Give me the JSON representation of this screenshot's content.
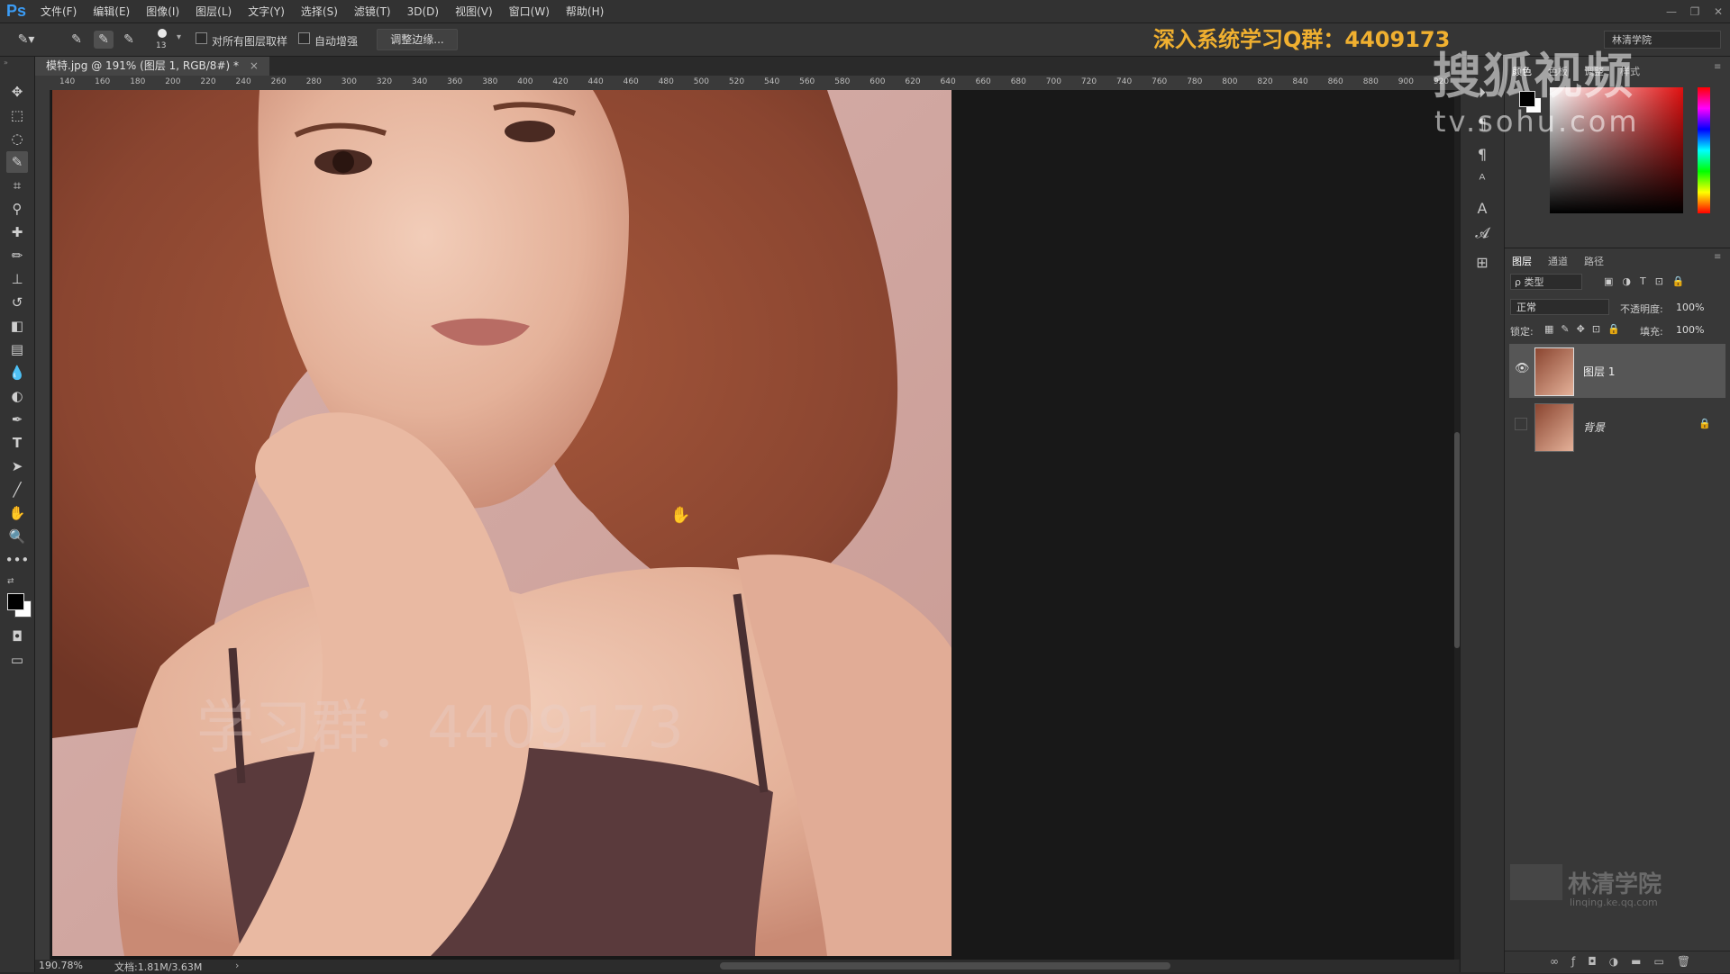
{
  "app": {
    "logo": "Ps"
  },
  "menu": [
    "文件(F)",
    "编辑(E)",
    "图像(I)",
    "图层(L)",
    "文字(Y)",
    "选择(S)",
    "滤镜(T)",
    "3D(D)",
    "视图(V)",
    "窗口(W)",
    "帮助(H)"
  ],
  "window_controls": [
    "—",
    "❐",
    "✕"
  ],
  "options_bar": {
    "brush_size": "13",
    "sample_all_layers_label": "对所有图层取样",
    "auto_enhance_label": "自动增强",
    "refine_edge_label": "调整边缘..."
  },
  "promo_banner": "深入系统学习Q群：4409173",
  "workspace": "林清学院",
  "document": {
    "tab_title": "模特.jpg @ 191% (图层 1, RGB/8#) *",
    "close": "×"
  },
  "ruler": {
    "h_labels": [
      "140",
      "160",
      "180",
      "200",
      "220",
      "240",
      "260",
      "280",
      "300",
      "320",
      "340",
      "360",
      "380",
      "400",
      "420",
      "440",
      "460",
      "480",
      "500",
      "520",
      "540",
      "560",
      "580",
      "600",
      "620",
      "640",
      "660",
      "680",
      "700",
      "720",
      "740",
      "760",
      "780",
      "800",
      "820",
      "840",
      "860",
      "880",
      "900",
      "920"
    ]
  },
  "status": {
    "zoom": "190.78%",
    "doc": "文档:1.81M/3.63M"
  },
  "color_panel": {
    "tabs": [
      "颜色",
      "色板",
      "调整",
      "样式"
    ]
  },
  "layers_panel": {
    "tabs": [
      "图层",
      "通道",
      "路径"
    ],
    "filter_kind": "ρ 类型",
    "blend_mode": "正常",
    "opacity_label": "不透明度:",
    "opacity_value": "100%",
    "lock_label": "锁定:",
    "fill_label": "填充:",
    "fill_value": "100%",
    "layers": [
      {
        "name": "图层 1",
        "visible": true,
        "selected": true,
        "locked": false
      },
      {
        "name": "背景",
        "visible": false,
        "selected": false,
        "locked": true
      }
    ]
  },
  "watermarks": {
    "sohu_logo": "搜狐视频",
    "sohu_url": "tv.sohu.com",
    "canvas_text": "学习群：4409173",
    "academy": "林清学院",
    "academy_url": "linqing.ke.qq.com"
  },
  "colors": {
    "accent_promo": "#f0b030",
    "ps_blue": "#3b9cf5",
    "panel_bg": "#383838",
    "canvas_bg": "#181818"
  },
  "icons": [
    "move-icon",
    "marquee-icon",
    "lasso-icon",
    "quick-select-icon",
    "crop-icon",
    "eyedropper-icon",
    "healing-icon",
    "brush-icon",
    "stamp-icon",
    "history-brush-icon",
    "eraser-icon",
    "gradient-icon",
    "blur-icon",
    "dodge-icon",
    "pen-icon",
    "type-icon",
    "path-select-icon",
    "line-icon",
    "hand-icon",
    "zoom-icon",
    "more-icon"
  ]
}
